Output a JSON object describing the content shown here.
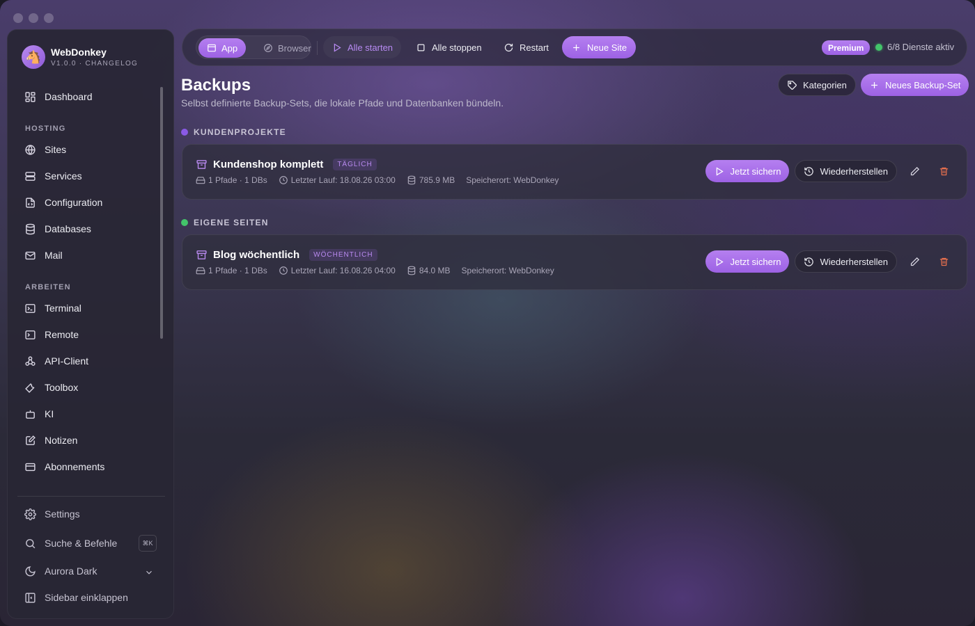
{
  "app": {
    "name": "WebDonkey",
    "version": "V1.0.0 · CHANGELOG",
    "accent": "#a56de9"
  },
  "sidebar": {
    "dashboard": "Dashboard",
    "section_hosting": "HOSTING",
    "hosting": [
      "Sites",
      "Services",
      "Configuration",
      "Databases",
      "Mail"
    ],
    "section_arbeiten": "ARBEITEN",
    "arbeiten": [
      "Terminal",
      "Remote",
      "API-Client",
      "Toolbox",
      "KI",
      "Notizen",
      "Abonnements"
    ],
    "settings": "Settings",
    "search": "Suche & Befehle",
    "search_shortcut": "⌘K",
    "theme": "Aurora Dark",
    "collapse": "Sidebar einklappen"
  },
  "topbar": {
    "mode_app": "App",
    "mode_browser": "Browser",
    "start_all": "Alle starten",
    "stop_all": "Alle stoppen",
    "restart": "Restart",
    "new_site": "Neue Site",
    "premium": "Premium",
    "services_status": "6/8 Dienste aktiv",
    "status_color": "#43c46a"
  },
  "page": {
    "title": "Backups",
    "subtitle": "Selbst definierte Backup-Sets, die lokale Pfade und Datenbanken bündeln.",
    "categories_button": "Kategorien",
    "new_backup_button": "Neues Backup-Set"
  },
  "groups": [
    {
      "label": "KUNDENPROJEKTE",
      "color": "#8a5ae6",
      "items": [
        {
          "name": "Kundenshop komplett",
          "frequency": "TÄGLICH",
          "paths": "1 Pfade · 1 DBs",
          "last_run": "Letzter Lauf: 18.08.26 03:00",
          "size": "785.9 MB",
          "location": "Speicherort: WebDonkey"
        }
      ]
    },
    {
      "label": "EIGENE SEITEN",
      "color": "#43c46a",
      "items": [
        {
          "name": "Blog wöchentlich",
          "frequency": "WÖCHENTLICH",
          "paths": "1 Pfade · 1 DBs",
          "last_run": "Letzter Lauf: 16.08.26 04:00",
          "size": "84.0 MB",
          "location": "Speicherort: WebDonkey"
        }
      ]
    }
  ],
  "actions": {
    "backup_now": "Jetzt sichern",
    "restore": "Wiederherstellen"
  },
  "colors": {
    "delete": "#e8704e"
  }
}
